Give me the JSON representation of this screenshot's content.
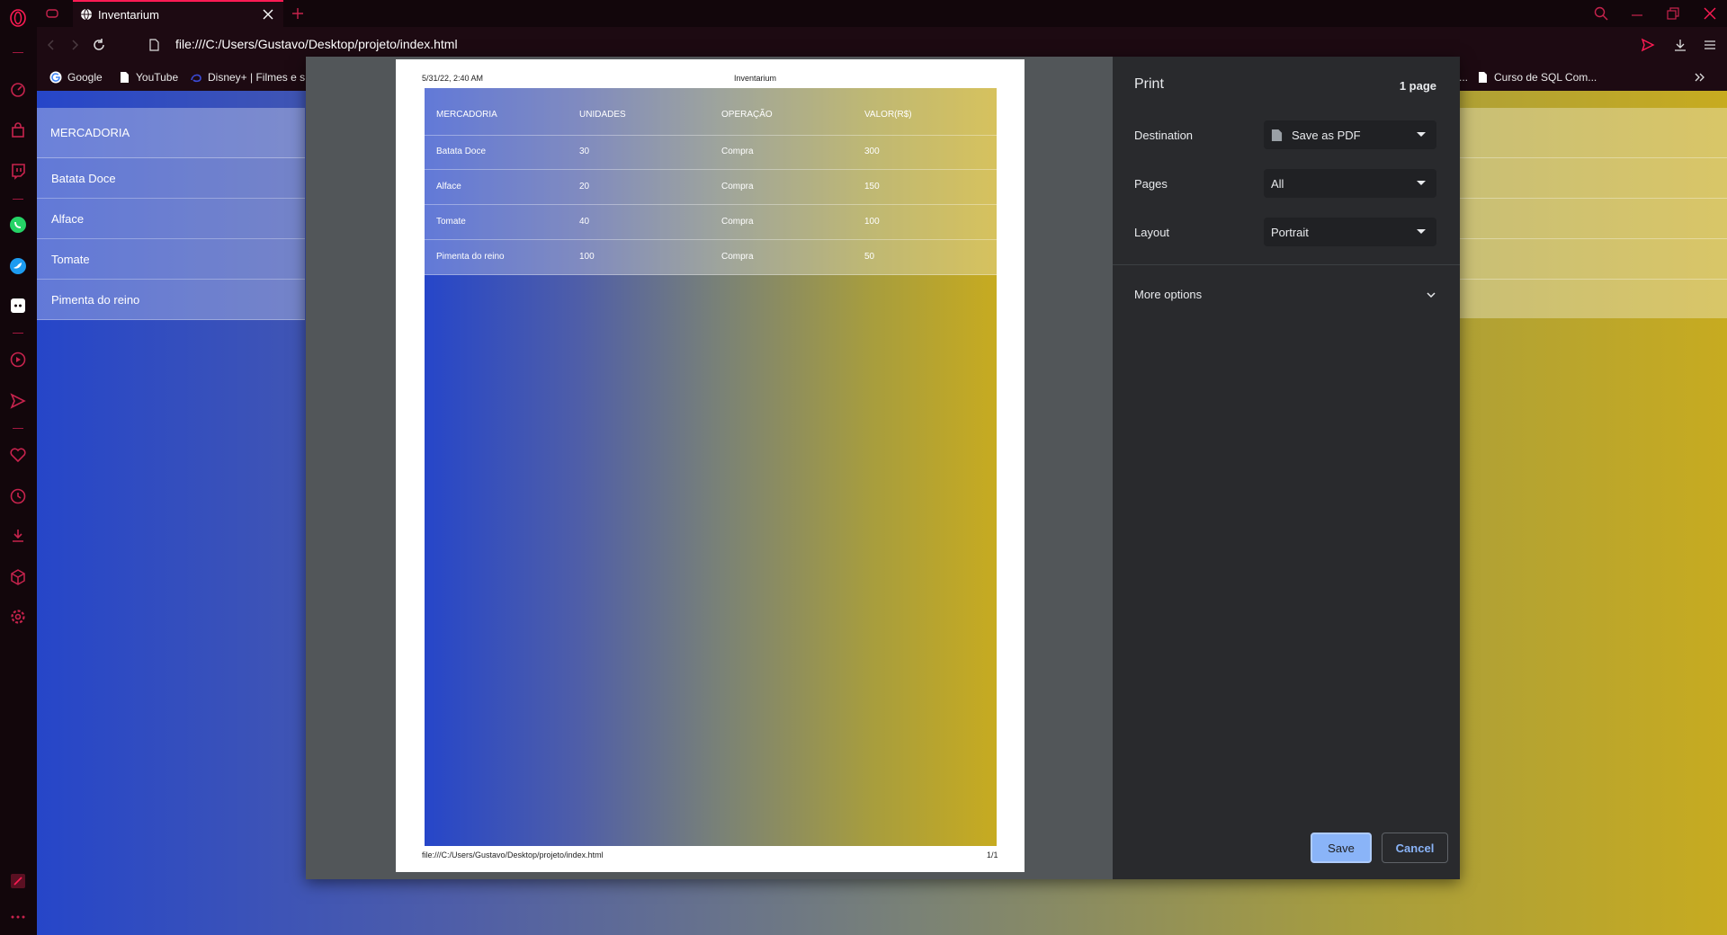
{
  "tab": {
    "title": "Inventarium"
  },
  "address": {
    "url": "file:///C:/Users/Gustavo/Desktop/projeto/index.html"
  },
  "bookmarks": [
    {
      "label": "Google",
      "icon": "google-icon"
    },
    {
      "label": "YouTube",
      "icon": "page-icon"
    },
    {
      "label": "Disney+ | Filmes e s",
      "icon": "disney-icon"
    },
    {
      "label": "...",
      "icon": ""
    },
    {
      "label": "Curso de SQL Com...",
      "icon": "page-icon"
    }
  ],
  "page": {
    "header": "MERCADORIA",
    "rows": [
      "Batata Doce",
      "Alface",
      "Tomate",
      "Pimenta do reino"
    ]
  },
  "preview": {
    "date": "5/31/22, 2:40 AM",
    "title": "Inventarium",
    "footer_url": "file:///C:/Users/Gustavo/Desktop/projeto/index.html",
    "page_num": "1/1",
    "table": {
      "headers": [
        "MERCADORIA",
        "UNIDADES",
        "OPERAÇÃO",
        "VALOR(R$)"
      ],
      "rows": [
        [
          "Batata Doce",
          "30",
          "Compra",
          "300"
        ],
        [
          "Alface",
          "20",
          "Compra",
          "150"
        ],
        [
          "Tomate",
          "40",
          "Compra",
          "100"
        ],
        [
          "Pimenta do reino",
          "100",
          "Compra",
          "50"
        ]
      ]
    }
  },
  "print": {
    "title": "Print",
    "page_count": "1 page",
    "destination_label": "Destination",
    "destination_value": "Save as PDF",
    "pages_label": "Pages",
    "pages_value": "All",
    "layout_label": "Layout",
    "layout_value": "Portrait",
    "more_options": "More options",
    "save": "Save",
    "cancel": "Cancel"
  },
  "colors": {
    "opera_accent": "#ff1b54",
    "dialog_bg": "#292a2d",
    "button_primary": "#8ab4f8",
    "page_gradient_start": "#2646c9",
    "page_gradient_end": "#c7ab20"
  }
}
